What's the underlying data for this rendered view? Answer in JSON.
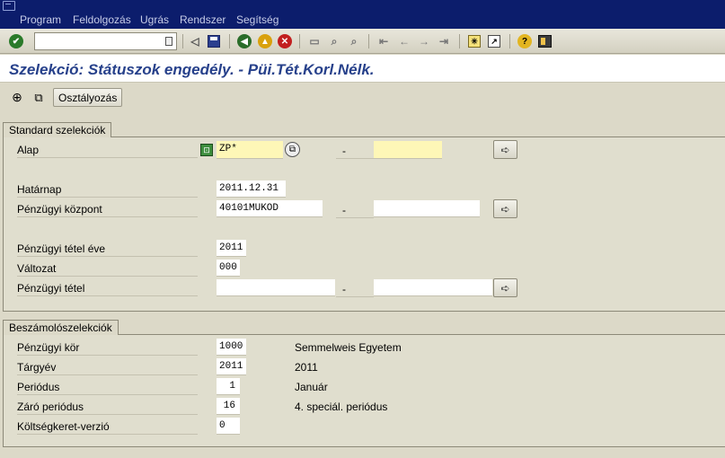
{
  "menu": [
    "Program",
    "Feldolgozás",
    "Ugrás",
    "Rendszer",
    "Segítség"
  ],
  "toolbar": {
    "command_value": "",
    "icons": [
      "check-icon",
      "back-triangle-icon",
      "save-icon",
      "back-icon",
      "exit-icon",
      "cancel-icon",
      "print-icon",
      "find-icon",
      "find-next-icon",
      "first-page-icon",
      "prev-page-icon",
      "next-page-icon",
      "last-page-icon",
      "new-session-icon",
      "shortcut-icon",
      "help-icon",
      "layout-icon"
    ]
  },
  "title": "Szelekció: Státuszok engedély. - Püi.Tét.Korl.Nélk.",
  "app_toolbar": {
    "execute_icon": "execute-icon",
    "variant_icon": "variant-icon",
    "allocation_label": "Osztályozás"
  },
  "standard": {
    "title": "Standard szelekciók",
    "alap_label": "Alap",
    "alap_value": "ZP*",
    "hatarnap_label": "Határnap",
    "hatarnap_value": "2011.12.31",
    "kozpont_label": "Pénzügyi központ",
    "kozpont_value": "40101MUKOD",
    "ev_label": "Pénzügyi tétel éve",
    "ev_value": "2011",
    "valtozat_label": "Változat",
    "valtozat_value": "000",
    "tetel_label": "Pénzügyi tétel",
    "tetel_value": "",
    "dash": "-"
  },
  "report": {
    "title": "Beszámolószelekciók",
    "kor_label": "Pénzügyi kör",
    "kor_value": "1000",
    "kor_desc": "Semmelweis Egyetem",
    "targyev_label": "Tárgyév",
    "targyev_value": "2011",
    "targyev_desc": "2011",
    "periodus_label": "Periódus",
    "periodus_value": "1",
    "periodus_desc": "Január",
    "zaro_label": "Záró periódus",
    "zaro_value": "16",
    "zaro_desc": "4. speciál. periódus",
    "verzio_label": "Költségkeret-verzió",
    "verzio_value": "0"
  }
}
